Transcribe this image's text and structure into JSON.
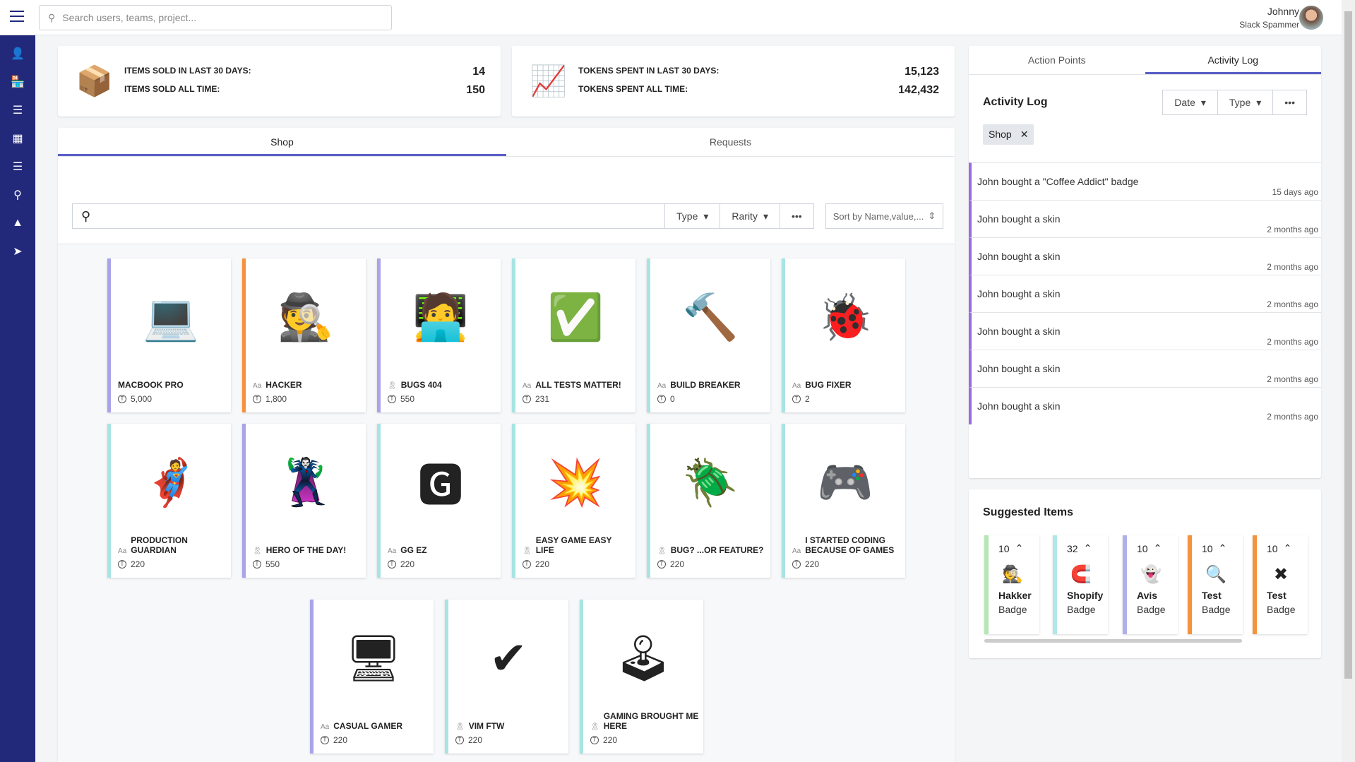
{
  "header": {
    "search_placeholder": "Search users, teams, project...",
    "user_name": "Johnny",
    "user_role": "Slack Spammer"
  },
  "sidebar": {
    "items": [
      "profile-icon",
      "shop-icon",
      "reports-icon",
      "stats-icon",
      "layers-icon",
      "branch-icon",
      "mountain-icon",
      "send-icon"
    ]
  },
  "stats": {
    "items_30_label": "ITEMS SOLD IN LAST 30 DAYS:",
    "items_30": "14",
    "items_all_label": "ITEMS SOLD ALL TIME:",
    "items_all": "150",
    "tokens_30_label": "TOKENS SPENT IN LAST 30 DAYS:",
    "tokens_30": "15,123",
    "tokens_all_label": "TOKENS SPENT ALL TIME:",
    "tokens_all": "142,432"
  },
  "shop": {
    "tabs": [
      "Shop",
      "Requests"
    ],
    "filters": {
      "type": "Type",
      "rarity": "Rarity",
      "sort": "Sort by Name,value,..."
    },
    "items": [
      {
        "name": "MACBOOK PRO",
        "price": "5,000",
        "kind": "",
        "color": "#a9a3ea",
        "img": "💻"
      },
      {
        "name": "HACKER",
        "price": "1,800",
        "kind": "text",
        "color": "#f5923e",
        "img": "🕵"
      },
      {
        "name": "BUGS 404",
        "price": "550",
        "kind": "badge",
        "color": "#a9a3ea",
        "img": "🧑‍💻"
      },
      {
        "name": "ALL TESTS MATTER!",
        "price": "231",
        "kind": "text",
        "color": "#a8e4e4",
        "img": "✅"
      },
      {
        "name": "BUILD BREAKER",
        "price": "0",
        "kind": "text",
        "color": "#a8e4e4",
        "img": "🔨"
      },
      {
        "name": "BUG FIXER",
        "price": "2",
        "kind": "text",
        "color": "#a8e4e4",
        "img": "🐞"
      },
      {
        "name": "PRODUCTION GUARDIAN",
        "price": "220",
        "kind": "text",
        "color": "#a8e4e4",
        "img": "🦸"
      },
      {
        "name": "HERO OF THE DAY!",
        "price": "550",
        "kind": "badge",
        "color": "#a9a3ea",
        "img": "🦹"
      },
      {
        "name": "GG EZ",
        "price": "220",
        "kind": "text",
        "color": "#a8e4e4",
        "img": "🅶"
      },
      {
        "name": "EASY GAME EASY LIFE",
        "price": "220",
        "kind": "badge",
        "color": "#a8e4e4",
        "img": "💥"
      },
      {
        "name": "BUG? ...OR FEATURE?",
        "price": "220",
        "kind": "badge",
        "color": "#a8e4e4",
        "img": "🪲"
      },
      {
        "name": "I STARTED CODING BECAUSE OF GAMES",
        "price": "220",
        "kind": "text",
        "color": "#a8e4e4",
        "img": "🎮"
      },
      {
        "name": "CASUAL GAMER",
        "price": "220",
        "kind": "text",
        "color": "#a9a3ea",
        "img": "🖥"
      },
      {
        "name": "VIM FTW",
        "price": "220",
        "kind": "badge",
        "color": "#a8e4e4",
        "img": "✔"
      },
      {
        "name": "GAMING BROUGHT ME HERE",
        "price": "220",
        "kind": "badge",
        "color": "#a8e4e4",
        "img": "🕹"
      }
    ]
  },
  "activity": {
    "tabs": [
      "Action Points",
      "Activity Log"
    ],
    "title": "Activity Log",
    "date": "Date",
    "type": "Type",
    "chip": "Shop",
    "entries": [
      {
        "text": "John bought a \"Coffee Addict\" badge",
        "ago": "15 days ago"
      },
      {
        "text": "John bought a skin",
        "ago": "2 months ago"
      },
      {
        "text": "John bought a skin",
        "ago": "2 months ago"
      },
      {
        "text": "John bought a skin",
        "ago": "2 months ago"
      },
      {
        "text": "John bought a skin",
        "ago": "2 months ago"
      },
      {
        "text": "John bought a skin",
        "ago": "2 months ago"
      },
      {
        "text": "John bought a skin",
        "ago": "2 months ago"
      }
    ]
  },
  "suggested": {
    "title": "Suggested Items",
    "items": [
      {
        "count": "10",
        "name": "Hakker",
        "kind": "Badge",
        "color": "#b5e6b5",
        "img": "🕵"
      },
      {
        "count": "32",
        "name": "Shopify",
        "kind": "Badge",
        "color": "#b0e8e8",
        "img": "🧲"
      },
      {
        "count": "10",
        "name": "Avis",
        "kind": "Badge",
        "color": "#b1b0ea",
        "img": "👻"
      },
      {
        "count": "10",
        "name": "Test",
        "kind": "Badge",
        "color": "#f5923e",
        "img": "🔍"
      },
      {
        "count": "10",
        "name": "Test",
        "kind": "Badge",
        "color": "#f5923e",
        "img": "✖"
      }
    ]
  }
}
